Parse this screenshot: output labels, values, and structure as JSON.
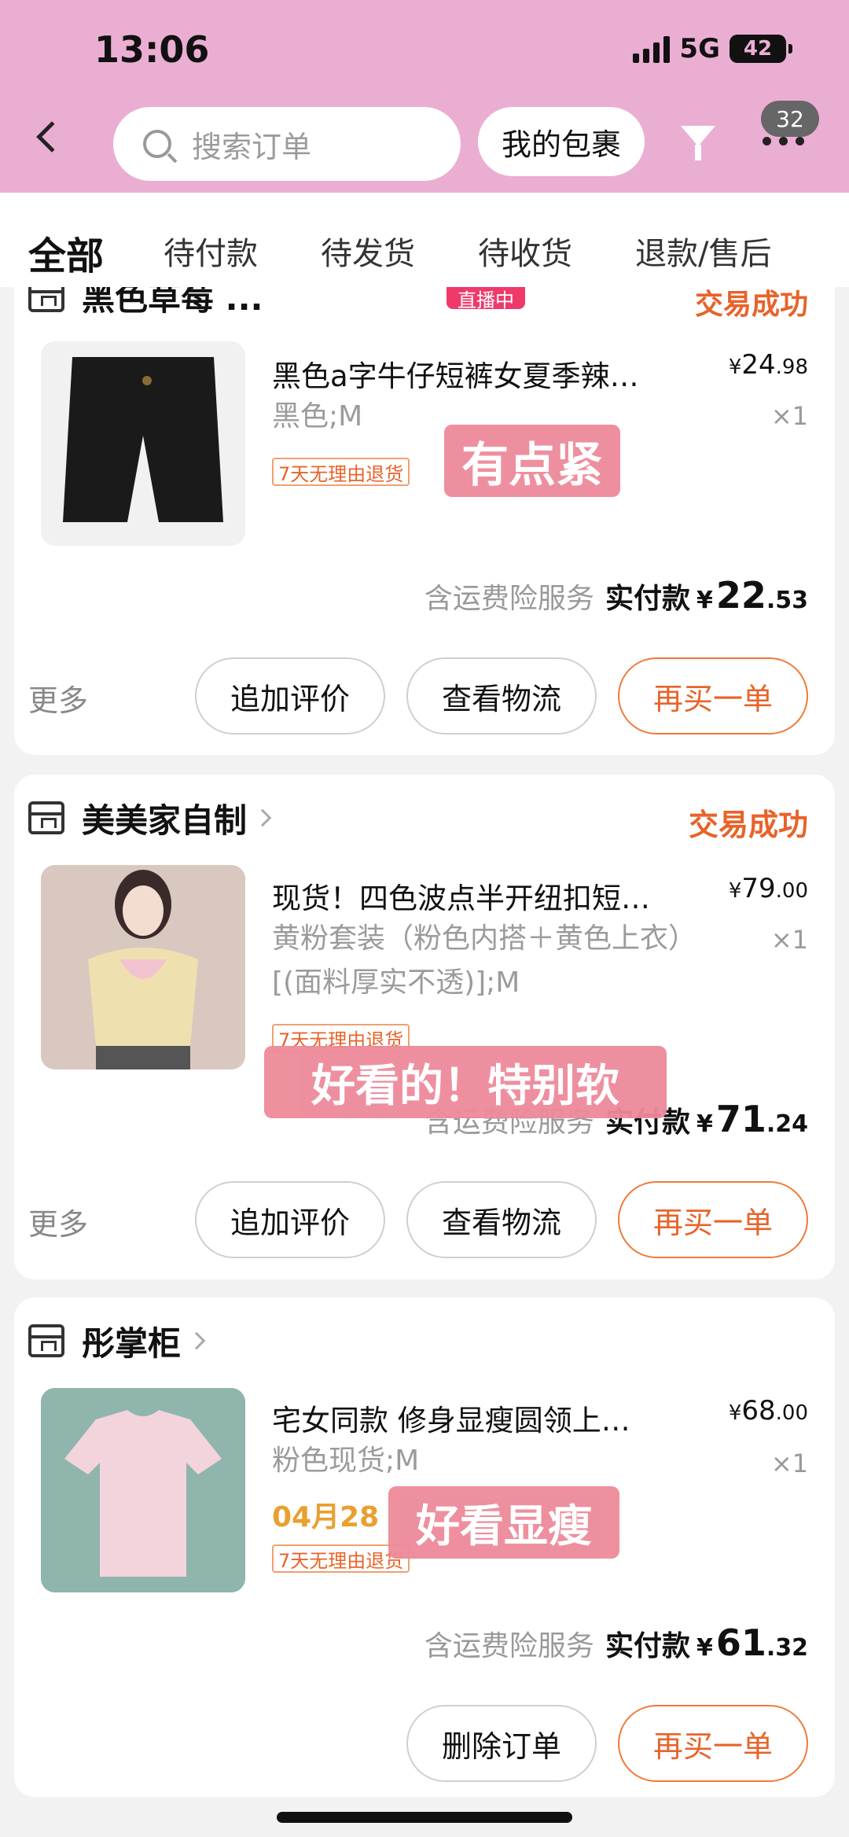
{
  "status_bar": {
    "time": "13:06",
    "network": "5G",
    "battery": "42"
  },
  "header": {
    "search_placeholder": "搜索订单",
    "package_button": "我的包裹",
    "message_count": "32"
  },
  "tabs": [
    "全部",
    "待付款",
    "待发货",
    "待收货",
    "退款/售后"
  ],
  "orders": [
    {
      "shop": "黑色草莓 ...",
      "live_badge": "直播中",
      "status": "交易成功",
      "title": "黑色a字牛仔短裤女夏季辣…",
      "spec": "黑色;M",
      "price_int": "24",
      "price_dec": ".98",
      "qty": "×1",
      "return_tag": "7天无理由退货",
      "insurance": "含运费险服务",
      "pay_label": "实付款",
      "pay_int": "22",
      "pay_dec": ".53",
      "more": "更多",
      "buttons": [
        "追加评价",
        "查看物流",
        "再买一单"
      ],
      "sticker": "有点紧",
      "thumb_colors": {
        "bg": "#f1f1f1",
        "item": "#1a1a1a"
      }
    },
    {
      "shop": "美美家自制",
      "status": "交易成功",
      "title": "现货！四色波点半开纽扣短…",
      "spec": "黄粉套装（粉色内搭＋黄色上衣）[(面料厚实不透)];M",
      "price_int": "79",
      "price_dec": ".00",
      "qty": "×1",
      "return_tag": "7天无理由退货",
      "insurance": "含运费险服务",
      "pay_label": "实付款",
      "pay_int": "71",
      "pay_dec": ".24",
      "more": "更多",
      "buttons": [
        "追加评价",
        "查看物流",
        "再买一单"
      ],
      "sticker": "好看的！特别软",
      "thumb_colors": {
        "bg": "#d8c8c0",
        "item": "#efe0b0"
      }
    },
    {
      "shop": "彤掌柜",
      "title": "宅女同款 修身显瘦圆领上…",
      "spec": "粉色现货;M",
      "date": "04月28",
      "price_int": "68",
      "price_dec": ".00",
      "qty": "×1",
      "return_tag": "7天无理由退货",
      "insurance": "含运费险服务",
      "pay_label": "实付款",
      "pay_int": "61",
      "pay_dec": ".32",
      "buttons": [
        "删除订单",
        "再买一单"
      ],
      "sticker": "好看显瘦",
      "thumb_colors": {
        "bg": "#8fb5ad",
        "item": "#f4d4dc"
      }
    }
  ],
  "currency": "¥",
  "colors": {
    "header_bg": "#ebaed3",
    "accent": "#e8632a",
    "sticker": "#ee8a9a"
  }
}
